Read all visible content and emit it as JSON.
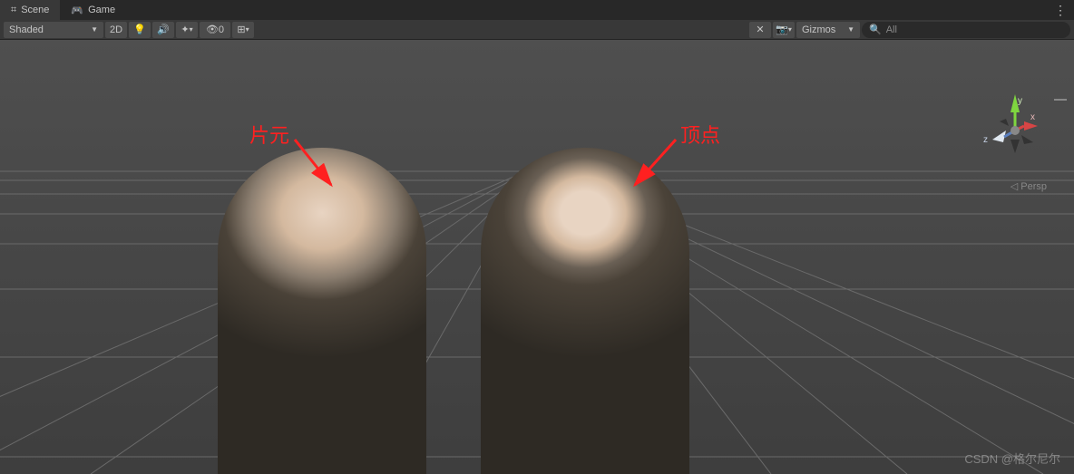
{
  "tabs": {
    "scene": "Scene",
    "game": "Game"
  },
  "toolbar": {
    "shading_mode": "Shaded",
    "view_2d": "2D",
    "hidden_count": "0",
    "gizmos_label": "Gizmos"
  },
  "search": {
    "placeholder": "All"
  },
  "annotations": {
    "left_label": "片元",
    "right_label": "顶点"
  },
  "gizmo": {
    "axis_x": "x",
    "axis_y": "y",
    "axis_z": "z",
    "perspective": "Persp"
  },
  "watermark": "CSDN @格尔尼尔"
}
